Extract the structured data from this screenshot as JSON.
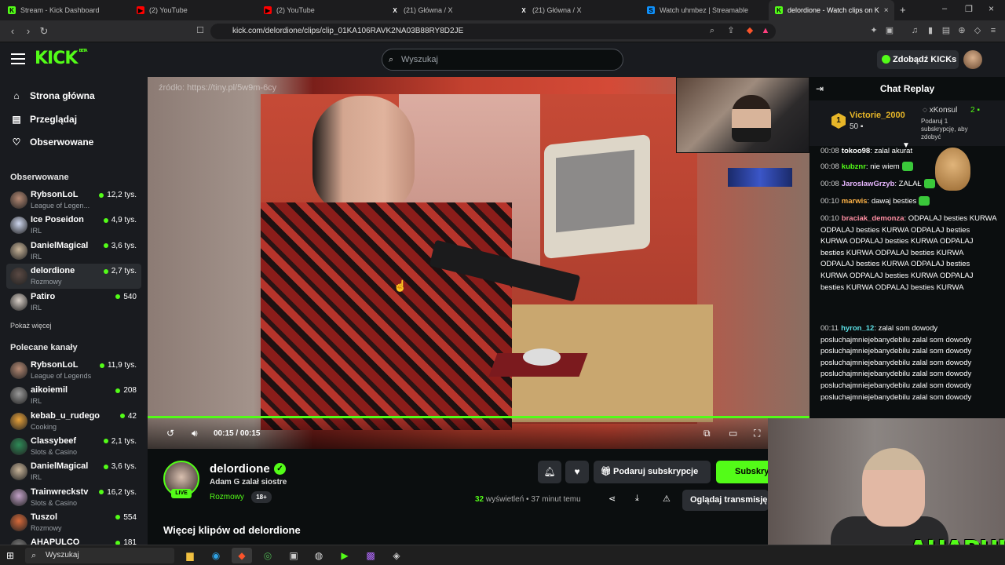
{
  "browser": {
    "tabs": [
      {
        "label": "Stream - Kick Dashboard",
        "icon": "kick-icon",
        "color": "#53fc18"
      },
      {
        "label": "(2) YouTube",
        "icon": "youtube-icon",
        "color": "#ff0000"
      },
      {
        "label": "(2) YouTube",
        "icon": "youtube-icon",
        "color": "#ff0000"
      },
      {
        "label": "(21) Główna / X",
        "icon": "x-icon",
        "color": "#ffffff"
      },
      {
        "label": "(21) Główna / X",
        "icon": "x-icon",
        "color": "#ffffff"
      },
      {
        "label": "Watch uhmbez | Streamable",
        "icon": "streamable-icon",
        "color": "#0f90fa"
      },
      {
        "label": "delordione - Watch clips on K",
        "icon": "kick-icon",
        "color": "#53fc18"
      }
    ],
    "url": "kick.com/delordione/clips/clip_01KA106RAVK2NA03B88RY8D2JE"
  },
  "header": {
    "logo": "KICK",
    "logo_badge": "BETA",
    "search_placeholder": "Wyszukaj",
    "kicks_button": "Zdobądź KICKs"
  },
  "sidebar": {
    "nav": [
      {
        "label": "Strona główna",
        "icon": "home-icon"
      },
      {
        "label": "Przeglądaj",
        "icon": "browse-icon"
      },
      {
        "label": "Obserwowane",
        "icon": "heart-icon"
      }
    ],
    "followed_title": "Obserwowane",
    "followed": [
      {
        "name": "RybsonLoL",
        "category": "League of Legen...",
        "viewers": "12,2 tys.",
        "color": "#b58a74"
      },
      {
        "name": "Ice Poseidon",
        "category": "IRL",
        "viewers": "4,9 tys.",
        "color": "#cfd8f0"
      },
      {
        "name": "DanielMagical",
        "category": "IRL",
        "viewers": "3,6 tys.",
        "color": "#c9b59a"
      },
      {
        "name": "delordione",
        "category": "Rozmowy",
        "viewers": "2,7 tys.",
        "color": "#5b4a44"
      },
      {
        "name": "Patiro",
        "category": "IRL",
        "viewers": "540",
        "color": "#d9d0c8"
      }
    ],
    "show_more": "Pokaż więcej",
    "recommended_title": "Polecane kanały",
    "recommended": [
      {
        "name": "RybsonLoL",
        "category": "League of Legends",
        "viewers": "11,9 tys.",
        "color": "#b58a74"
      },
      {
        "name": "aikoiemil",
        "category": "IRL",
        "viewers": "208",
        "color": "#9a9a9a"
      },
      {
        "name": "kebab_u_rudego",
        "category": "Cooking",
        "viewers": "42",
        "color": "#e8a23a"
      },
      {
        "name": "Classybeef",
        "category": "Slots & Casino",
        "viewers": "2,1 tys.",
        "color": "#2e8b57"
      },
      {
        "name": "DanielMagical",
        "category": "IRL",
        "viewers": "3,6 tys.",
        "color": "#c9b59a"
      },
      {
        "name": "Trainwreckstv",
        "category": "Slots & Casino",
        "viewers": "16,2 tys.",
        "color": "#c3a2c8"
      },
      {
        "name": "Tuszol",
        "category": "Rozmowy",
        "viewers": "554",
        "color": "#d86a3a"
      },
      {
        "name": "AHAPULCO",
        "category": "",
        "viewers": "181",
        "color": "#7a7a7a"
      }
    ]
  },
  "video": {
    "source_watermark": "źródło: https://tiny.pl/5w9m-6cy",
    "current_time": "00:15",
    "duration": "00:15",
    "progress": 1.0
  },
  "chat": {
    "title": "Chat Replay",
    "leaderboard": [
      {
        "rank": "1",
        "name": "Victorie_2000",
        "amount": "50"
      },
      {
        "name": "xKonsul",
        "amount": "2",
        "note": "Podaruj 1 subskrypcję, aby zdobyć"
      }
    ],
    "messages": [
      {
        "time": "00:08",
        "user": "tokoo98",
        "color": "#ffffff",
        "text": "zalal akurat",
        "emote": false
      },
      {
        "time": "00:08",
        "user": "kubznr",
        "color": "#53fc18",
        "text": "nie wiem",
        "emote": true
      },
      {
        "time": "00:08",
        "user": "JaroslawGrzyb",
        "color": "#e7b6ff",
        "text": "ZALAŁ",
        "emote": true
      },
      {
        "time": "00:10",
        "user": "marwis",
        "color": "#ffb347",
        "text": "dawaj besties",
        "emote": true
      },
      {
        "time": "00:10",
        "user": "braciak_demonza",
        "color": "#ff8fa3",
        "text": "ODPALAJ besties KURWA ODPALAJ besties KURWA ODPALAJ besties KURWA ODPALAJ besties KURWA ODPALAJ besties KURWA ODPALAJ besties KURWA ODPALAJ besties KURWA ODPALAJ besties KURWA ODPALAJ besties KURWA ODPALAJ besties KURWA ODPALAJ besties KURWA",
        "emote": false
      },
      {
        "time": "00:11",
        "user": "hyron_12",
        "color": "#5ce0e6",
        "text": "zalal som dowody posluchajmniejebanydebilu zalal som dowody posluchajmniejebanydebilu zalal som dowody posluchajmniejebanydebilu zalal som dowody posluchajmniejebanydebilu zalal som dowody posluchajmniejebanydebilu zalal som dowody posluchajmniejebanydebilu zalal som dowody",
        "emote": false
      }
    ]
  },
  "channel": {
    "name": "delordione",
    "clip_title": "Adam G zalał siostre",
    "category": "Rozmowy",
    "age_rating": "18+",
    "live_badge": "LIVE",
    "gift_button": "Podaruj subskrypcje",
    "subscribe_button": "Subskrybuj",
    "views_count": "32",
    "views_label": "wyświetleń",
    "posted": "37 minut temu",
    "watch_button": "Oglądaj transmisję",
    "more_clips": "Więcej klipów od delordione"
  },
  "overlay": {
    "logo": "AHAPULCO"
  },
  "taskbar": {
    "search_placeholder": "Wyszukaj"
  }
}
